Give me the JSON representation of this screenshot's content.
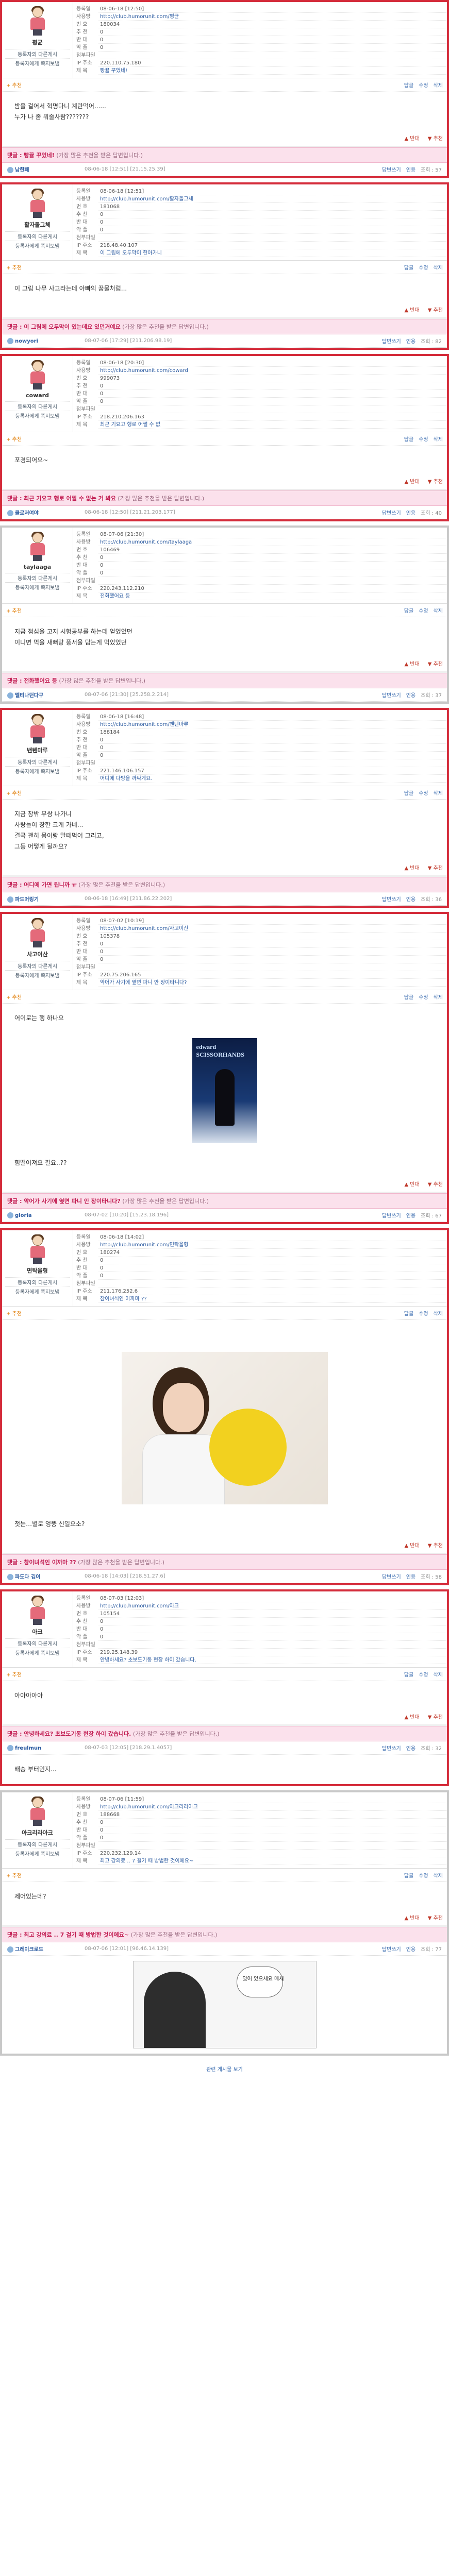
{
  "labels": {
    "k1": "등록일",
    "k2": "사용방",
    "k3": "번 호",
    "k4": "추 천",
    "k5": "반 대",
    "k6": "악 플",
    "k7": "첨부파일",
    "k8": "IP 주소",
    "k9": "제 목",
    "profile_btn1": "등록자의 다른게시",
    "profile_btn2": "등록자에게 쪽지보냄",
    "plus": "+ 추천",
    "tool_a": "답글",
    "tool_b": "수정",
    "tool_c": "삭제",
    "vote_up": "▲ 반대",
    "vote_down": "▼ 추천",
    "reply_prefix": "댓글 : ",
    "reply_hint": "(가장 많은 추천을 받은 답변입니다.)",
    "meta_l1": "답변쓰기",
    "meta_l2": "인용",
    "page_bar": "관련 게시물 보기"
  },
  "posts": [
    {
      "nick": "평균",
      "date": "08-06-18 [12:50]",
      "url": "http://club.humorunit.com/평균",
      "num": "180034",
      "vote": "0",
      "anti": "0",
      "bad": "0",
      "file": "",
      "ip": "220.110.75.180",
      "title": "빵뀰 꾸었네!",
      "body": [
        "밤을 걸어서 혁명다니 계란먹어......",
        "누가 나 좀 뭐줄사람???????"
      ],
      "reply": {
        "title": "빵뀰 꾸었네!",
        "author": "남한패",
        "date": "08-06-18 [12:51]",
        "sub": "[21.15.25.39]",
        "count": "조회 : 57"
      },
      "highlight": true
    },
    {
      "nick": "활자돌그체",
      "date": "08-06-18 [12:51]",
      "url": "http://club.humorunit.com/활자돌그체",
      "num": "181068",
      "vote": "0",
      "anti": "0",
      "bad": "0",
      "file": "",
      "ip": "218.48.40.107",
      "title": "이 그림에 오두막이 한아가니",
      "body": [
        "이 그림 나무 사고라는데 아빠의 꿈물처럼..."
      ],
      "reply": {
        "title": "이 그림에 오두막이 있는데요 있던거예요",
        "author": "nowyori",
        "date": "08-07-06 [17:29]",
        "sub": "[211.206.98.19]",
        "count": "조회 : 82"
      },
      "highlight": true
    },
    {
      "nick": "coward",
      "date": "08-06-18 [20:30]",
      "url": "http://club.humorunit.com/coward",
      "num": "999073",
      "vote": "0",
      "anti": "0",
      "bad": "0",
      "file": "",
      "ip": "218.210.206.163",
      "title": "최근 기요고 행로 어쩔 수 없",
      "body": [
        "포경되어요~"
      ],
      "reply": {
        "title": "최근 기요고 행로 어쩔 수 없는 거 봐요",
        "author": "클로저여야",
        "date": "08-06-18 [12:50]",
        "sub": "[211.21.203.177]",
        "count": "조회 : 40"
      },
      "highlight": true
    },
    {
      "nick": "taylaaga",
      "date": "08-07-06 [21:30]",
      "url": "http://club.humorunit.com/taylaaga",
      "num": "106469",
      "vote": "0",
      "anti": "0",
      "bad": "0",
      "file": "",
      "ip": "220.243.112.210",
      "title": "전화했어요 등",
      "body": [
        "지금 점심을 고지 시험공부를 하는데 얻었었던",
        "이니면 먹을 새뻐랑 풍서울 담는게 먹었었던"
      ],
      "reply": {
        "title": "전화했어요 등",
        "author": "멜티나던다구",
        "date": "08-07-06 [21:30]",
        "sub": "[25.258.2.214]",
        "count": "조회 : 37"
      },
      "highlight": false
    },
    {
      "nick": "밴텐마루",
      "date": "08-06-18 [16:48]",
      "url": "http://club.humorunit.com/밴텐마루",
      "num": "188184",
      "vote": "0",
      "anti": "0",
      "bad": "0",
      "file": "",
      "ip": "221.146.106.157",
      "title": "어디에 다방을 까싸게요.",
      "body": [
        "지금 창밖 무쌍 나가니",
        "사랑들이 장한 크게 가네...",
        "결국 괜히 몸이랑 말떼먹어 그리고,",
        "그동 어떻게 될까요?"
      ],
      "reply": {
        "title": "어디에 가면 됩니까 ㅠ",
        "author": "파드머링기",
        "date": "08-06-18 [16:49]",
        "sub": "[211.86.22.202]",
        "count": "조회 : 36"
      },
      "highlight": true
    },
    {
      "nick": "사고이산",
      "date": "08-07-02 [10:19]",
      "url": "http://club.humorunit.com/사고이산",
      "num": "105378",
      "vote": "0",
      "anti": "0",
      "bad": "0",
      "file": "",
      "ip": "220.75.206.165",
      "title": "악어가 사기에 옆면 파니 안 장이타니다?",
      "body": [
        "어이로는 행 하나요"
      ],
      "reply": {
        "title": "악어가 사기에 옆면 파니 안 장이타니다?",
        "author": "gloria",
        "date": "08-07-02 [10:20]",
        "sub": "[15.23.18.196]",
        "count": "조회 : 67"
      },
      "image": "scissor",
      "image_text": "edward SCISSORHANDS",
      "after": [
        "힘떨어져요 필요..??"
      ],
      "highlight": true
    },
    {
      "nick": "면탁을형",
      "date": "08-06-18 [14:02]",
      "url": "http://club.humorunit.com/면탁을형",
      "num": "180274",
      "vote": "0",
      "anti": "0",
      "bad": "0",
      "file": "",
      "ip": "211.176.252.6",
      "title": "참이녀석인 이까마 ??",
      "body": [],
      "image": "girl",
      "after": [
        "첫눈…별로 엉뚱 신일요소?"
      ],
      "reply": {
        "title": "참이녀석인 이까마 ??",
        "author": "파도다 김이",
        "date": "08-06-18 [14:03]",
        "sub": "[218.51.27.6]",
        "count": "조회 : 58"
      },
      "highlight": true
    },
    {
      "nick": "아크",
      "date": "08-07-03 [12:03]",
      "url": "http://club.humorunit.com/아크",
      "num": "105154",
      "vote": "0",
      "anti": "0",
      "bad": "0",
      "file": "",
      "ip": "219.25.148.39",
      "title": "안녕하세요? 초보도기동 현장 하이 갔습니다.",
      "body": [
        "아아아아아"
      ],
      "reply": {
        "title": "안녕하세요? 초보도기동 현장 하이 갔습니다.",
        "author": "freulmun",
        "date": "08-07-03 [12:05]",
        "sub": "[218.29.1.4057]",
        "count": "조회 : 32"
      },
      "after2": [
        "배송 부터인지..."
      ],
      "highlight": true
    },
    {
      "nick": "아크리라아크",
      "date": "08-07-06 [11:59]",
      "url": "http://club.humorunit.com/아크리라아크",
      "num": "188668",
      "vote": "0",
      "anti": "0",
      "bad": "0",
      "file": "",
      "ip": "220.232.129.14",
      "title": "최고 강의료 .. 7 걸기 때 방법한 것이에요~",
      "body": [
        "제어있는데?"
      ],
      "reply": {
        "title": "최고 강의료 .. 7 걸기 때 방법한 것이에요~",
        "author": "그레이크로드",
        "date": "08-07-06 [12:01]",
        "sub": "[96.46.14.139]",
        "count": "조회 : 77"
      },
      "image": "comic",
      "image_text": "있어 있으세요 메세",
      "highlight": false
    }
  ],
  "colors": {
    "highlight_border": "#d42b3a",
    "reply_bg": "#fbe1ec",
    "link": "#3d6eb0"
  }
}
